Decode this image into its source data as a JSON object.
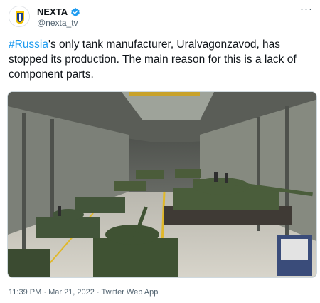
{
  "author": {
    "display_name": "NEXTA",
    "handle": "@nexta_tv",
    "verified": true,
    "avatar_icon": "nexta-logo"
  },
  "menu": {
    "more_label": "···"
  },
  "tweet": {
    "hashtag": "#Russia",
    "text_rest": "'s only tank manufacturer, Uralvagonzavod, has stopped its production. The main reason for this is a lack of component parts."
  },
  "media": {
    "alt": "Tank assembly hall with rows of tanks on the factory floor"
  },
  "meta": {
    "time": "11:39 PM",
    "date": "Mar 21, 2022",
    "source": "Twitter Web App",
    "separator": " · "
  },
  "colors": {
    "accent": "#1d9bf0",
    "text": "#0f1419",
    "muted": "#536471",
    "logo_yellow": "#f2c200",
    "logo_blue": "#1a3f8c"
  }
}
